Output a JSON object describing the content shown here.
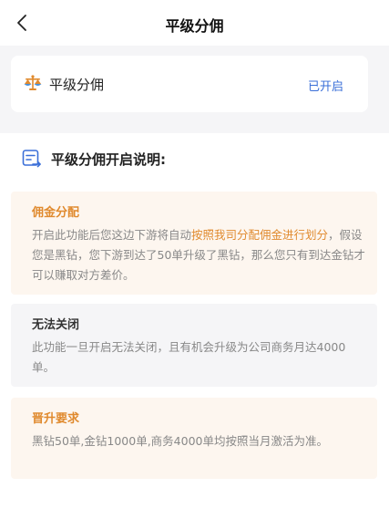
{
  "nav": {
    "title": "平级分佣"
  },
  "card": {
    "label": "平级分佣",
    "status": "已开启"
  },
  "section": {
    "heading": "平级分佣开启说明:"
  },
  "blocks": [
    {
      "title": "佣金分配",
      "text_before": "开启此功能后您这边下游将自动",
      "text_highlight": "按照我司分配佣金进行划分",
      "text_after": "，假设您是黑钻，您下游到达了50单升级了黑钻，那么您只有到达金钻才可以赚取对方差价。"
    },
    {
      "title": "无法关闭",
      "text": "此功能一旦开启无法关闭，且有机会升级为公司商务月达4000单。"
    },
    {
      "title": "晋升要求",
      "text": "黑钻50单,金钻1000单,商务4000单均按照当月激活为准。"
    }
  ],
  "colors": {
    "accent_orange": "#e08a2e",
    "status_blue": "#3a6fd8",
    "gray_bg": "#f5f5f7",
    "orange_bg": "#fdf6ef"
  },
  "icons": {
    "back": "chevron-left-icon",
    "scale": "balance-scale-icon",
    "note": "note-arrow-icon"
  }
}
